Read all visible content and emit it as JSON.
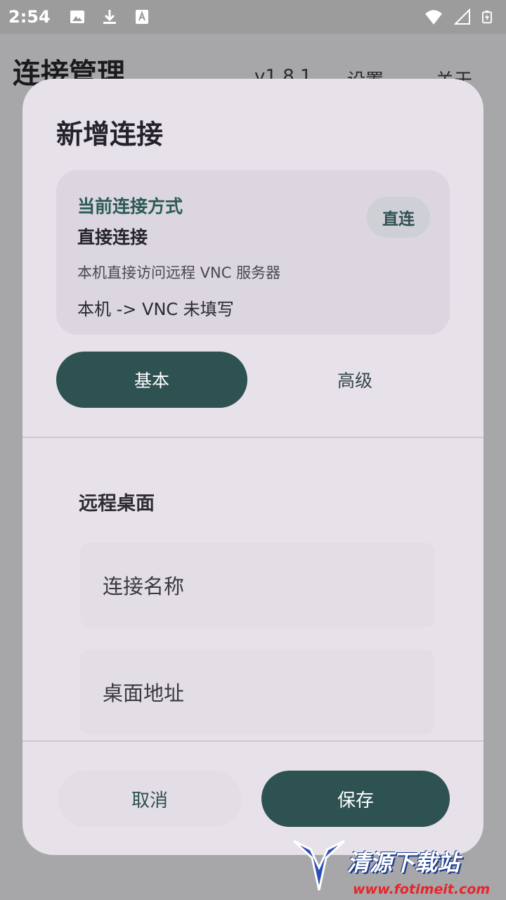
{
  "status_bar": {
    "time": "2:54",
    "left_icons": [
      "image-icon",
      "download-icon",
      "a-text-icon"
    ],
    "right_icons": [
      "wifi-icon",
      "signal-icon",
      "battery-charging-icon"
    ]
  },
  "app": {
    "title": "连接管理",
    "menu": [
      "v1.8.1",
      "设置",
      "关于"
    ]
  },
  "dialog": {
    "title": "新增连接",
    "card": {
      "label": "当前连接方式",
      "value": "直接连接",
      "description": "本机直接访问远程 VNC 服务器",
      "status": "本机 -> VNC 未填写",
      "badge": "直连"
    },
    "tabs": [
      {
        "label": "基本",
        "active": true
      },
      {
        "label": "高级",
        "active": false
      }
    ],
    "section_title": "远程桌面",
    "fields": {
      "name_placeholder": "连接名称",
      "address_placeholder": "桌面地址"
    },
    "buttons": {
      "cancel": "取消",
      "save": "保存"
    }
  },
  "watermark": {
    "text": "清源下载站",
    "url": "www.fotimeit.com"
  },
  "colors": {
    "accent": "#2e5152",
    "dialog_bg": "#e7e1ea",
    "scrim": "#a7a6a8"
  }
}
